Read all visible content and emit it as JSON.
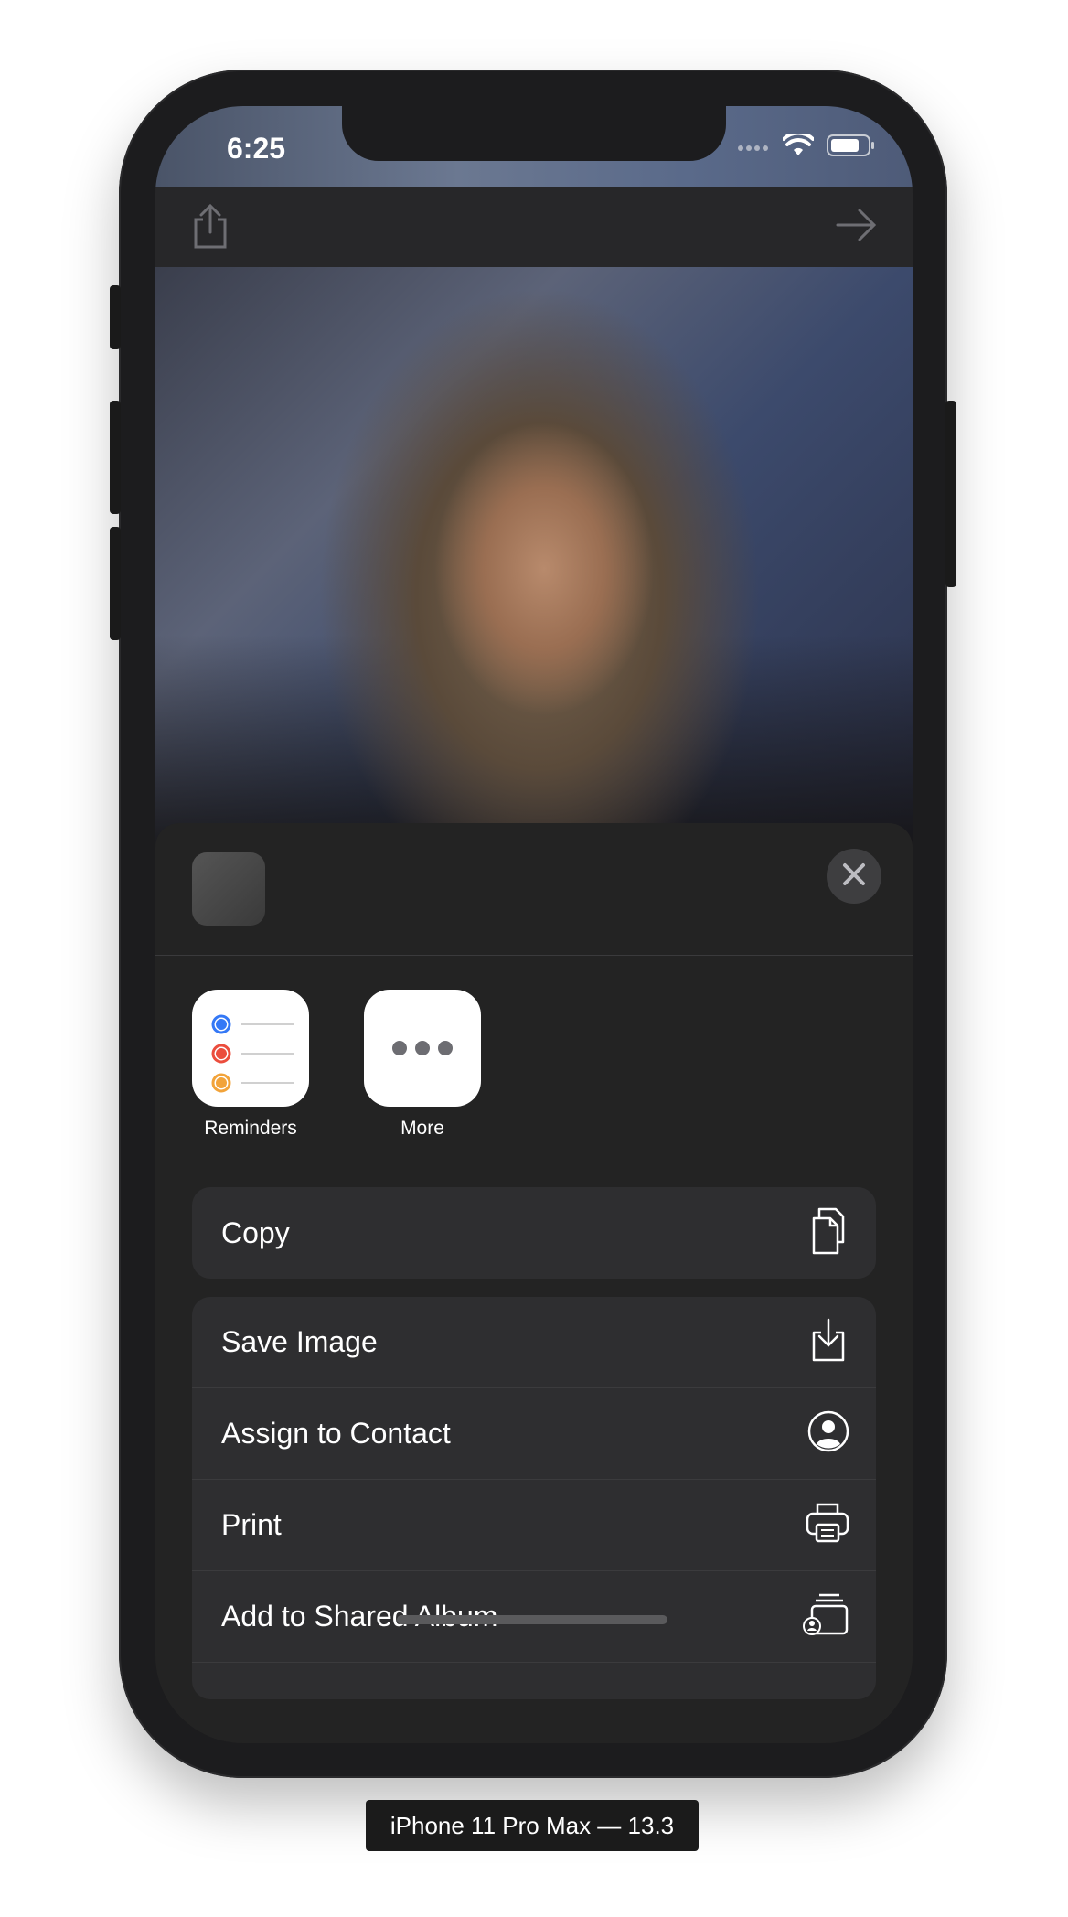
{
  "status_bar": {
    "time": "6:25"
  },
  "toolbar": {
    "share_icon": "share-icon",
    "forward_icon": "arrow-right-icon"
  },
  "share_sheet": {
    "apps": [
      {
        "label": "Reminders",
        "icon": "reminders-icon"
      },
      {
        "label": "More",
        "icon": "more-icon"
      }
    ],
    "copy_action": {
      "label": "Copy",
      "icon": "copy-icon"
    },
    "actions": [
      {
        "label": "Save Image",
        "icon": "save-image-icon"
      },
      {
        "label": "Assign to Contact",
        "icon": "contact-icon"
      },
      {
        "label": "Print",
        "icon": "printer-icon"
      },
      {
        "label": "Add to Shared Album",
        "icon": "shared-album-icon"
      }
    ]
  },
  "device_caption": "iPhone 11 Pro Max — 13.3",
  "colors": {
    "sheet_background": "#232323",
    "action_background": "#2e2e30",
    "reminders_blue": "#3478f6",
    "reminders_red": "#eb4d3d",
    "reminders_orange": "#f2a33a"
  }
}
